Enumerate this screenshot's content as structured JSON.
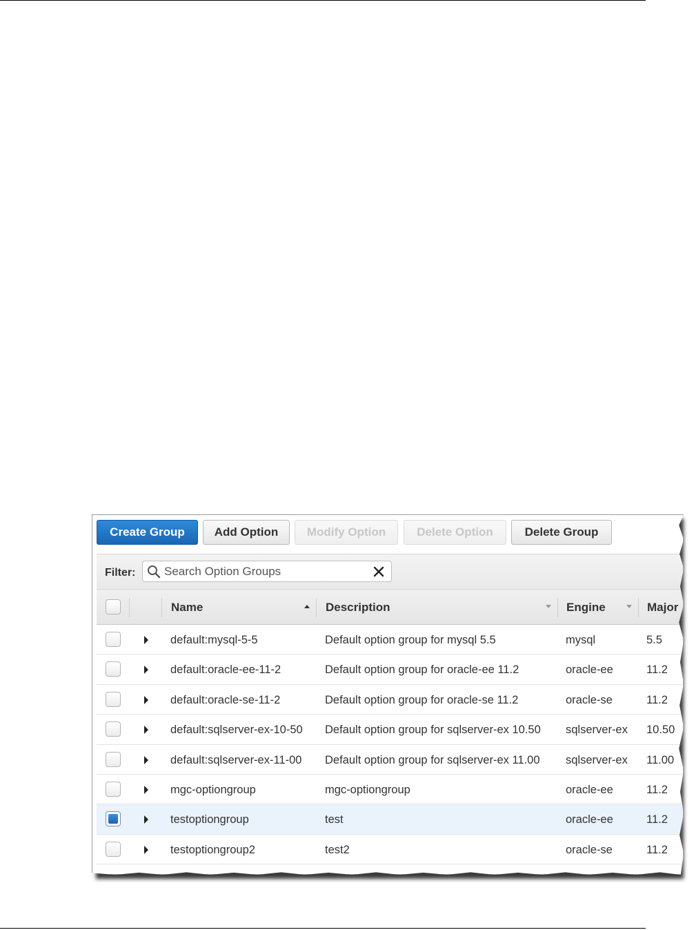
{
  "toolbar": {
    "create_group": "Create Group",
    "add_option": "Add Option",
    "modify_option": "Modify Option",
    "delete_option": "Delete Option",
    "delete_group": "Delete Group"
  },
  "filter": {
    "label": "Filter:",
    "placeholder": "Search Option Groups",
    "value": ""
  },
  "columns": {
    "name": "Name",
    "description": "Description",
    "engine": "Engine",
    "major": "Major"
  },
  "sort": {
    "column": "name",
    "direction": "ascending"
  },
  "rows": [
    {
      "name": "default:mysql-5-5",
      "description": "Default option group for mysql 5.5",
      "engine": "mysql",
      "major": "5.5",
      "selected": false
    },
    {
      "name": "default:oracle-ee-11-2",
      "description": "Default option group for oracle-ee 11.2",
      "engine": "oracle-ee",
      "major": "11.2",
      "selected": false
    },
    {
      "name": "default:oracle-se-11-2",
      "description": "Default option group for oracle-se 11.2",
      "engine": "oracle-se",
      "major": "11.2",
      "selected": false
    },
    {
      "name": "default:sqlserver-ex-10-50",
      "description": "Default option group for sqlserver-ex 10.50",
      "engine": "sqlserver-ex",
      "major": "10.50",
      "selected": false
    },
    {
      "name": "default:sqlserver-ex-11-00",
      "description": "Default option group for sqlserver-ex 11.00",
      "engine": "sqlserver-ex",
      "major": "11.00",
      "selected": false
    },
    {
      "name": "mgc-optiongroup",
      "description": "mgc-optiongroup",
      "engine": "oracle-ee",
      "major": "11.2",
      "selected": false
    },
    {
      "name": "testoptiongroup",
      "description": "test",
      "engine": "oracle-ee",
      "major": "11.2",
      "selected": true
    },
    {
      "name": "testoptiongroup2",
      "description": "test2",
      "engine": "oracle-se",
      "major": "11.2",
      "selected": false
    }
  ],
  "colors": {
    "primary_button": "#1f72c4",
    "selected_row": "#eaf2fc",
    "checked_box": "#1a63b2"
  }
}
